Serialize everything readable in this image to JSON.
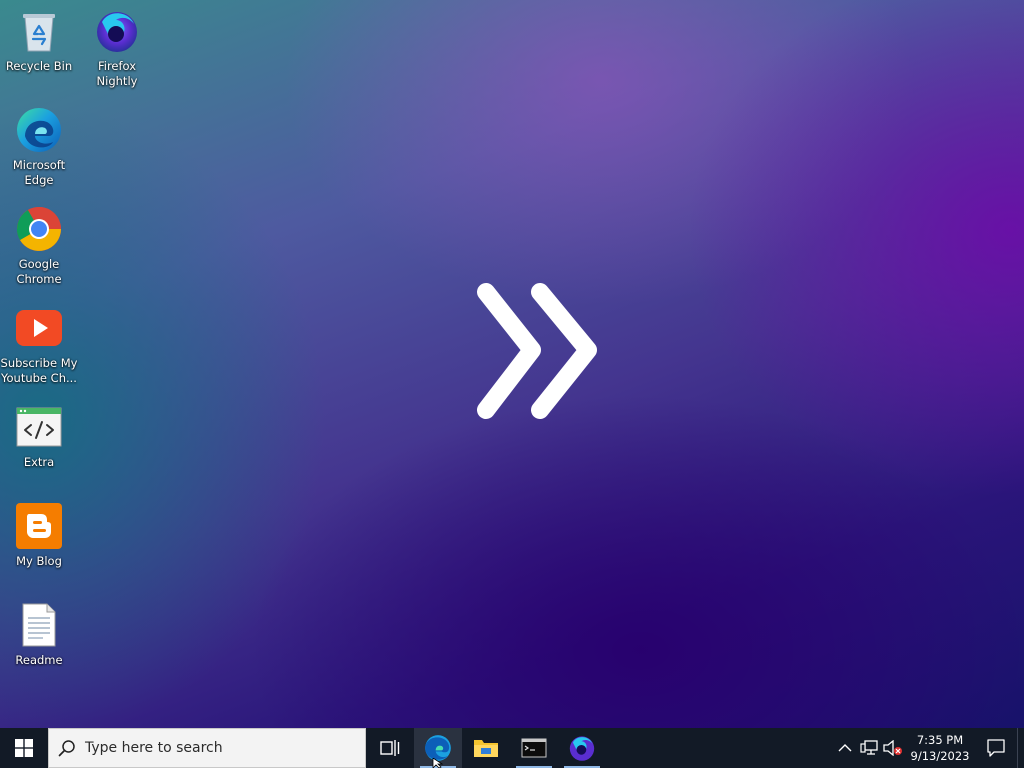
{
  "desktop": {
    "icons": [
      {
        "label": "Recycle Bin",
        "icon": "recycle-bin-icon"
      },
      {
        "label": "Firefox\nNightly",
        "icon": "firefox-nightly-icon"
      },
      {
        "label": "Microsoft\nEdge",
        "icon": "edge-icon"
      },
      {
        "label": "Google\nChrome",
        "icon": "chrome-icon"
      },
      {
        "label": "Subscribe My\nYoutube Ch...",
        "icon": "youtube-icon"
      },
      {
        "label": "Extra",
        "icon": "code-file-icon"
      },
      {
        "label": "My Blog",
        "icon": "blogger-icon"
      },
      {
        "label": "Readme",
        "icon": "text-document-icon"
      }
    ]
  },
  "taskbar": {
    "search_placeholder": "Type here to search",
    "pinned": [
      {
        "icon": "task-view-icon"
      },
      {
        "icon": "edge-icon",
        "active": true
      },
      {
        "icon": "file-explorer-icon"
      },
      {
        "icon": "terminal-icon",
        "running": true
      },
      {
        "icon": "firefox-nightly-icon",
        "running": true
      }
    ],
    "clock": {
      "time": "7:35 PM",
      "date": "9/13/2023"
    }
  },
  "colors": {
    "taskbar_bg": "#121a26",
    "running_indicator": "#8fb8e6",
    "text_white": "#ffffff"
  }
}
